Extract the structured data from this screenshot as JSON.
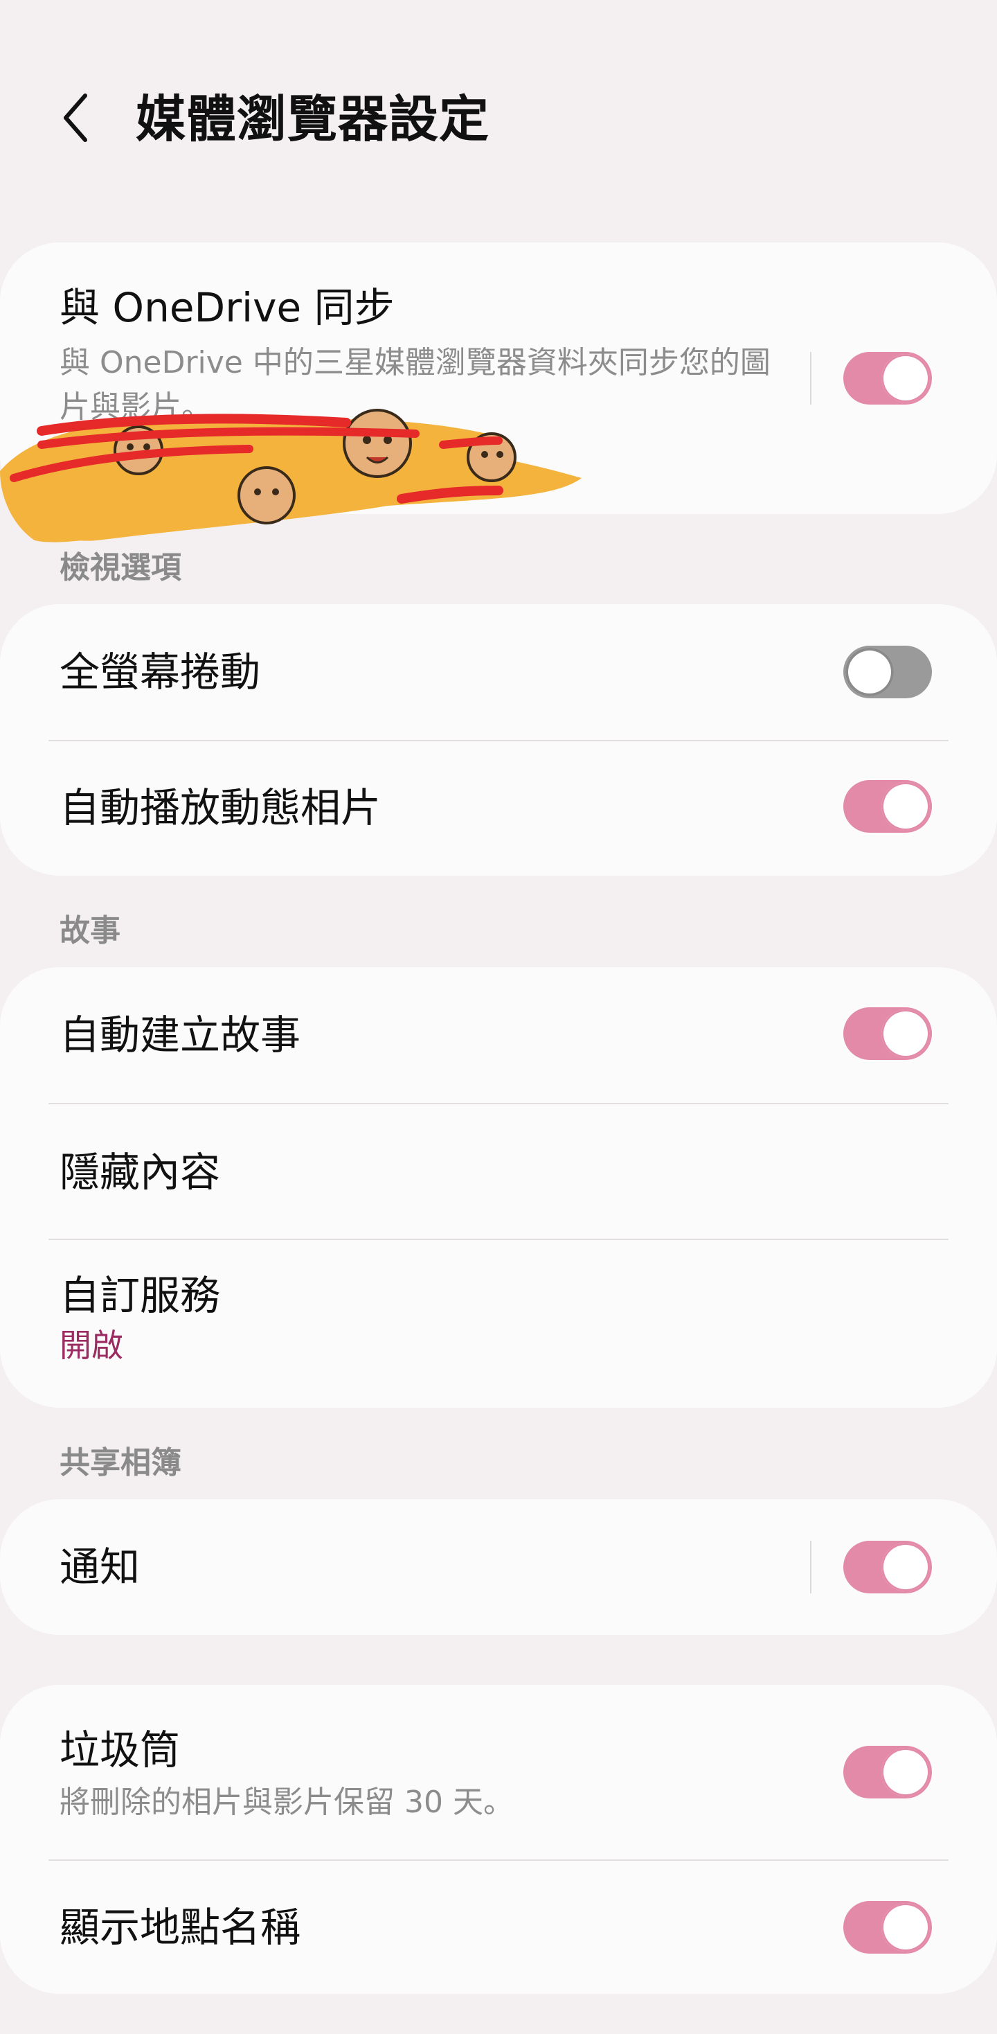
{
  "header": {
    "title": "媒體瀏覽器設定"
  },
  "sync": {
    "title": "與 OneDrive 同步",
    "subtitle": "與 OneDrive 中的三星媒體瀏覽器資料夾同步您的圖片與影片。",
    "enabled": true
  },
  "view_options": {
    "label": "檢視選項",
    "items": [
      {
        "title": "全螢幕捲動",
        "enabled": false
      },
      {
        "title": "自動播放動態相片",
        "enabled": true
      }
    ]
  },
  "stories": {
    "label": "故事",
    "auto_create": {
      "title": "自動建立故事",
      "enabled": true
    },
    "hide_content": {
      "title": "隱藏內容"
    },
    "custom_service": {
      "title": "自訂服務",
      "value": "開啟"
    }
  },
  "shared_albums": {
    "label": "共享相簿",
    "notifications": {
      "title": "通知",
      "enabled": true
    }
  },
  "misc": {
    "trash": {
      "title": "垃圾筒",
      "subtitle": "將刪除的相片與影片保留 30 天。",
      "enabled": true
    },
    "location_names": {
      "title": "顯示地點名稱",
      "enabled": true
    }
  },
  "colors": {
    "accent": "#e38aa9",
    "value_text": "#9b2c62",
    "background": "#f4f0f1",
    "card": "#fcfbfb"
  },
  "icons": {
    "back": "chevron-left-icon"
  }
}
